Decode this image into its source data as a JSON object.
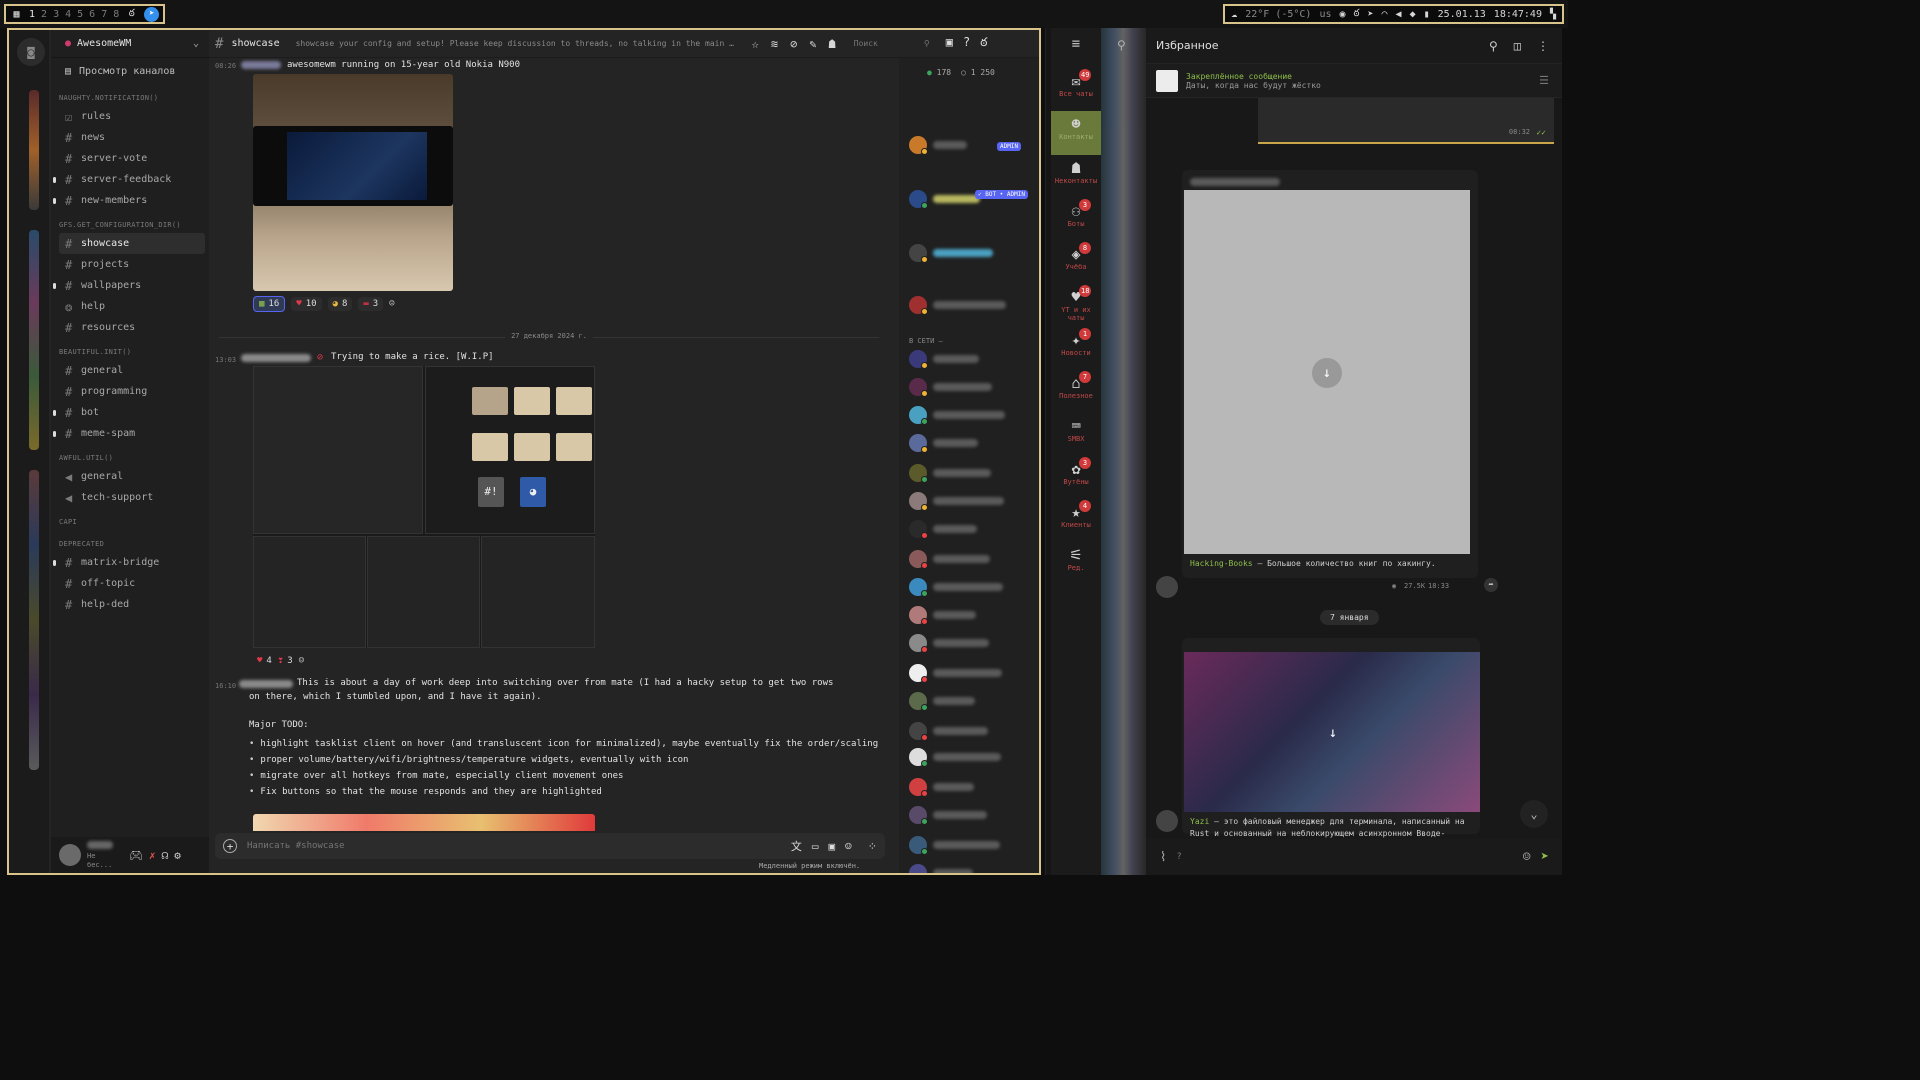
{
  "topbar": {
    "workspaces": [
      "1",
      "2",
      "3",
      "4",
      "5",
      "6",
      "7",
      "8"
    ],
    "current_workspace": "1",
    "weather": "22°F (-5°C)",
    "layout": "us",
    "date": "25.01.13",
    "time": "18:47:49"
  },
  "discord": {
    "server_name": "AwesomeWM",
    "browse_channels": "Просмотр каналов",
    "categories": [
      {
        "name": "NAUGHTY.NOTIFICATION()",
        "channels": [
          {
            "name": "rules",
            "icon": "rules-icon"
          },
          {
            "name": "news",
            "icon": "hash"
          },
          {
            "name": "server-vote",
            "icon": "hash"
          },
          {
            "name": "server-feedback",
            "icon": "hash",
            "unread": true
          },
          {
            "name": "new-members",
            "icon": "hash",
            "unread": true
          }
        ]
      },
      {
        "name": "GFS.GET_CONFIGURATION_DIR()",
        "channels": [
          {
            "name": "showcase",
            "icon": "hash",
            "active": true
          },
          {
            "name": "projects",
            "icon": "hash"
          },
          {
            "name": "wallpapers",
            "icon": "hash",
            "unread": true
          },
          {
            "name": "help",
            "icon": "forum-icon"
          },
          {
            "name": "resources",
            "icon": "hash"
          }
        ]
      },
      {
        "name": "BEAUTIFUL.INIT()",
        "channels": [
          {
            "name": "general",
            "icon": "hash"
          },
          {
            "name": "programming",
            "icon": "hash"
          },
          {
            "name": "bot",
            "icon": "hash",
            "unread": true
          },
          {
            "name": "meme-spam",
            "icon": "hash",
            "unread": true
          }
        ]
      },
      {
        "name": "AWFUL.UTIL()",
        "channels": [
          {
            "name": "general",
            "icon": "voice-icon"
          },
          {
            "name": "tech-support",
            "icon": "voice-icon"
          }
        ]
      },
      {
        "name": "CAPI",
        "channels": []
      },
      {
        "name": "DEPRECATED",
        "channels": [
          {
            "name": "matrix-bridge",
            "icon": "hash",
            "unread": true
          },
          {
            "name": "off-topic",
            "icon": "hash"
          },
          {
            "name": "help-ded",
            "icon": "hash"
          }
        ]
      }
    ],
    "user_status": "Не бес...",
    "channel": {
      "name": "showcase",
      "topic": "showcase your config and setup! Please keep discussion to threads, no talking in the main channel. Pl...",
      "search_placeholder": "Поиск"
    },
    "messages": [
      {
        "time": "08:26",
        "text": "awesomewm running on 15-year old Nokia N900",
        "reactions": [
          {
            "emoji": "▦",
            "count": "16"
          },
          {
            "emoji": "♥",
            "count": "10"
          },
          {
            "emoji": "◕",
            "count": "8"
          },
          {
            "emoji": "▬",
            "count": "3"
          }
        ]
      },
      {
        "date": "27 декабря 2024 г."
      },
      {
        "time": "13:03",
        "text": "Trying to make a rice. [W.I.P]",
        "reactions": [
          {
            "emoji": "♥",
            "count": "4"
          },
          {
            "emoji": "❣",
            "count": "3"
          }
        ]
      },
      {
        "time": "16:10",
        "text": "This is about a day of work deep into switching over from mate (I had a hacky setup to get two rows on there, which I stumbled upon, and I have it again).",
        "subtitle": "Major TODO:",
        "todo": [
          "highlight tasklist client on hover (and transluscent icon for minimalized), maybe eventually fix the order/scaling",
          "proper volume/battery/wifi/brightness/temperature widgets, eventually with icon",
          "migrate over all hotkeys from mate, especially client movement ones",
          "Fix buttons so that the mouse responds and they are highlighted"
        ]
      }
    ],
    "composer_placeholder": "Написать #showcase",
    "slowmode": "Медленный режим включён.",
    "members": {
      "online_count": "178",
      "total_count": "1 250",
      "section_online": "В СЕТИ —",
      "admin_badge": "ADMIN",
      "bot_badge": "✓ BOT • ADMIN"
    }
  },
  "telegram": {
    "title": "Избранное",
    "folders": [
      {
        "label": "Все чаты",
        "count": "49",
        "icon": "chats-icon"
      },
      {
        "label": "Контакты",
        "count": "",
        "icon": "contacts-icon",
        "selected": true
      },
      {
        "label": "Неконтакты",
        "count": "",
        "icon": "noncontacts-icon"
      },
      {
        "label": "Боты",
        "count": "3",
        "icon": "bot-icon"
      },
      {
        "label": "Учёба",
        "count": "8",
        "icon": "study-icon"
      },
      {
        "label": "YT и их чаты",
        "count": "18",
        "icon": "yt-icon"
      },
      {
        "label": "Новости",
        "count": "1",
        "icon": "news-icon"
      },
      {
        "label": "Полезное",
        "count": "7",
        "icon": "useful-icon"
      },
      {
        "label": "SMBX",
        "count": "",
        "icon": "gamepad-icon"
      },
      {
        "label": "Вутёны",
        "count": "3",
        "icon": "cat-icon"
      },
      {
        "label": "Клиенты",
        "count": "4",
        "icon": "star-icon"
      },
      {
        "label": "Ред.",
        "count": "",
        "icon": "edit-icon"
      }
    ],
    "pinned_title": "Закреплённое сообщение",
    "pinned_text": "Даты, когда нас будут жёстко",
    "msg_time": "08:32",
    "post1_channel": "Hacking-Books",
    "post1_text": " — Большое количество книг по хакингу.",
    "post1_views": "27.5K",
    "post1_time": "18:33",
    "date_chip": "7 января",
    "post2_channel": "Yazi",
    "post2_text": " — это файловый менеджер для терминала, написанный на Rust и основанный на неблокирующем асинхронном Вводе-Выводе.",
    "composer_placeholder": "?"
  }
}
